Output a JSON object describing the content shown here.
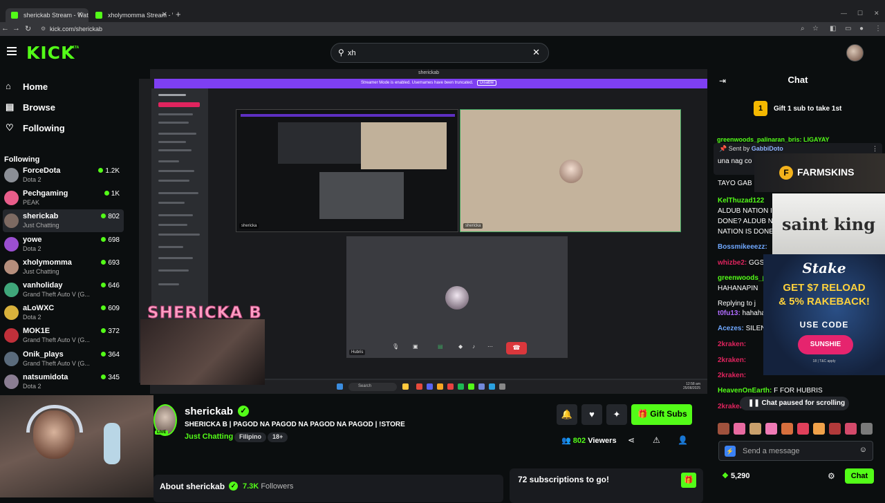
{
  "browser": {
    "tabs": [
      {
        "title": "sherickab Stream - Watch L"
      },
      {
        "title": "xholymomma Stream - Watch L"
      }
    ],
    "url": "kick.com/sherickab"
  },
  "header": {
    "logo": "KICK",
    "logo_badge": "BETA",
    "search_value": "xh"
  },
  "sidebar": {
    "nav": [
      {
        "label": "Home",
        "icon": "home-icon"
      },
      {
        "label": "Browse",
        "icon": "browse-icon"
      },
      {
        "label": "Following",
        "icon": "heart-icon"
      }
    ],
    "following_title": "Following",
    "channels": [
      {
        "name": "ForceDota",
        "game": "Dota 2",
        "viewers": "1.2K",
        "color": "#8b8f96"
      },
      {
        "name": "Pechgaming",
        "game": "PEAK",
        "viewers": "1K",
        "color": "#e85d8a"
      },
      {
        "name": "sherickab",
        "game": "Just Chatting",
        "viewers": "802",
        "color": "#7d6a62"
      },
      {
        "name": "yowe",
        "game": "Dota 2",
        "viewers": "698",
        "color": "#9b4fd1"
      },
      {
        "name": "xholymomma",
        "game": "Just Chatting",
        "viewers": "693",
        "color": "#b58e7c"
      },
      {
        "name": "vanholiday",
        "game": "Grand Theft Auto V (G...",
        "viewers": "646",
        "color": "#3fa77a"
      },
      {
        "name": "aLoWXC",
        "game": "Dota 2",
        "viewers": "609",
        "color": "#d9b23c"
      },
      {
        "name": "MOK1E",
        "game": "Grand Theft Auto V (G...",
        "viewers": "372",
        "color": "#c0303a"
      },
      {
        "name": "Onik_plays",
        "game": "Grand Theft Auto V (G...",
        "viewers": "364",
        "color": "#5a6b7c"
      },
      {
        "name": "natsumidota",
        "game": "Dota 2",
        "viewers": "345",
        "color": "#8a7d92"
      }
    ]
  },
  "video": {
    "window_title": "sherickab",
    "streamer_mode_banner": "Streamer Mode is enabled. Usernames have been truncated.",
    "disable_label": "Disable",
    "tile_labels": [
      "shericka",
      "shericka",
      "Hubris"
    ],
    "overlay_title": "SHERICKA B",
    "taskbar_search": "Search",
    "clock": "12:58 am\n25/08/2025"
  },
  "channel": {
    "live_label": "LIVE",
    "name": "sherickab",
    "stream_title": "SHERICKA B | PAGOD NA PAGOD NA PAGOD NA PAGOD | !STORE",
    "category": "Just Chatting",
    "tags": [
      "Filipino",
      "18+"
    ],
    "gift_subs_label": "Gift Subs",
    "viewers_count": "802",
    "viewers_label": "Viewers",
    "about_title": "About sherickab",
    "followers_count": "7.3K",
    "followers_label": "Followers",
    "sub_goal": "72 subscriptions to go!"
  },
  "chat": {
    "title": "Chat",
    "gift_badge": "1",
    "gift_text": "Gift 1 sub to take 1st",
    "pinned_header": "greenwoods_palinaran_bris: LIGAYAY",
    "pinned_by_prefix": "Sent by",
    "pinned_by_user": "GabbiDoto",
    "pinned_message": "una nag co",
    "messages": [
      {
        "user": "",
        "text": "TAYO GAB",
        "color": "#fff"
      },
      {
        "user": "KelThuzad122",
        "text": "",
        "color": "#53fc18"
      },
      {
        "user": "",
        "text": "ALDUB NATION IS",
        "color": "#fff"
      },
      {
        "user": "",
        "text": "DONE? ALDUB NA",
        "color": "#fff"
      },
      {
        "user": "",
        "text": "NATION IS DONE?",
        "color": "#fff"
      },
      {
        "user": "Bossmikeeezz:",
        "text": "",
        "color": "#6fa8ff"
      },
      {
        "user": "whizbe2:",
        "text": " GGS",
        "color": "#e0245e"
      },
      {
        "user": "greenwoods_p",
        "text": "",
        "color": "#53fc18"
      },
      {
        "user": "",
        "text": "HAHANAPIN",
        "color": "#fff"
      },
      {
        "user": "",
        "text": "Replying to j",
        "color": "#aaa"
      },
      {
        "user": "t0fu13:",
        "text": " hahaha",
        "color": "#b06cff"
      },
      {
        "user": "Acezes:",
        "text": " SILEN",
        "color": "#6fa8ff"
      },
      {
        "user": "2kraken:",
        "text": "",
        "color": "#e0245e"
      },
      {
        "user": "2kraken:",
        "text": "",
        "color": "#e0245e"
      },
      {
        "user": "2kraken:",
        "text": "",
        "color": "#e0245e"
      },
      {
        "user": "HeavenOnEarth:",
        "text": " F FOR HUBRIS",
        "color": "#53fc18"
      },
      {
        "user": "2kraker",
        "text": "",
        "color": "#e0245e"
      }
    ],
    "paused_label": "Chat paused for scrolling",
    "input_placeholder": "Send a message",
    "points": "5,290",
    "send_label": "Chat"
  },
  "ads": {
    "farmskins": "FARMSKINS",
    "saint_king": "saint king",
    "stake_logo": "Stake",
    "stake_line1": "GET $7 RELOAD",
    "stake_line2": "& 5% RAKEBACK!",
    "stake_code_label": "USE CODE",
    "stake_code": "SUNSHIE",
    "stake_fine": "18  |  T&C apply"
  }
}
